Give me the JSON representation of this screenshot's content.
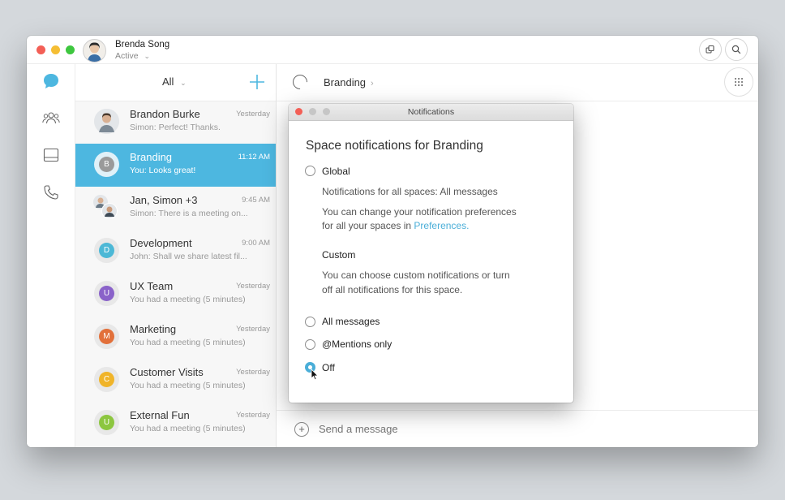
{
  "user": {
    "name": "Brenda Song",
    "status": "Active"
  },
  "list": {
    "filter": "All",
    "rows": [
      {
        "title": "Brandon Burke",
        "subtitle": "Simon: Perfect! Thanks.",
        "time": "Yesterday",
        "initial": "",
        "color": "#e8e8e8"
      },
      {
        "title": "Branding",
        "subtitle": "You: Looks great!",
        "time": "11:12 AM",
        "initial": "B",
        "color": "#9a9a9a"
      },
      {
        "title": "Jan, Simon +3",
        "subtitle": "Simon: There is a meeting on...",
        "time": "9:45 AM",
        "initial": "",
        "color": "#e8e8e8"
      },
      {
        "title": "Development",
        "subtitle": "John: Shall we share latest fil...",
        "time": "9:00 AM",
        "initial": "D",
        "color": "#4cb8d6"
      },
      {
        "title": "UX Team",
        "subtitle": "You had a meeting (5 minutes)",
        "time": "Yesterday",
        "initial": "U",
        "color": "#8a62c9"
      },
      {
        "title": "Marketing",
        "subtitle": "You had a meeting (5 minutes)",
        "time": "Yesterday",
        "initial": "M",
        "color": "#e2703a"
      },
      {
        "title": "Customer Visits",
        "subtitle": "You had a meeting (5 minutes)",
        "time": "Yesterday",
        "initial": "C",
        "color": "#f0b429"
      },
      {
        "title": "External Fun",
        "subtitle": "You had a meeting (5 minutes)",
        "time": "Yesterday",
        "initial": "U",
        "color": "#8cc63f"
      }
    ]
  },
  "main": {
    "space_title": "Branding",
    "composer_placeholder": "Send a message"
  },
  "dialog": {
    "window_title": "Notifications",
    "heading": "Space notifications for Branding",
    "global_label": "Global",
    "global_desc": "Notifications for all spaces: All messages",
    "prefs_line1": "You can change your notification preferences",
    "prefs_line2": "for all your spaces in ",
    "prefs_link": "Preferences.",
    "custom_label": "Custom",
    "custom_line1": "You can choose custom notifications or turn",
    "custom_line2": "off all notifications for this space.",
    "opt_all": "All messages",
    "opt_mentions": "@Mentions only",
    "opt_off": "Off",
    "selected": "Off"
  },
  "colors": {
    "accent": "#4db7e0",
    "link": "#4aaed8"
  }
}
